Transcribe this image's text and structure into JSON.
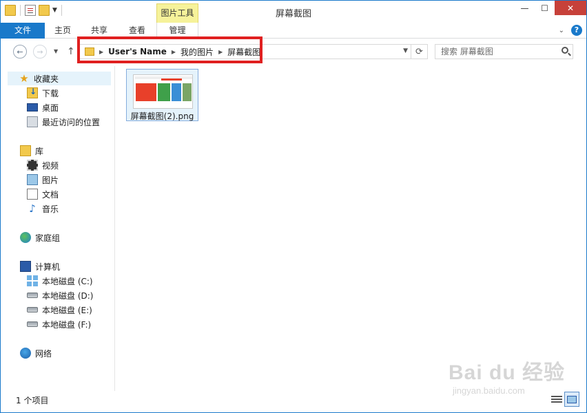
{
  "window": {
    "title": "屏幕截图",
    "contextual_tab_label": "图片工具"
  },
  "ribbon": {
    "tabs": [
      {
        "label": "文件"
      },
      {
        "label": "主页"
      },
      {
        "label": "共享"
      },
      {
        "label": "查看"
      },
      {
        "label": "管理"
      }
    ]
  },
  "address": {
    "breadcrumbs": [
      "User's Name",
      "我的图片",
      "屏幕截图"
    ]
  },
  "search": {
    "placeholder": "搜索 屏幕截图"
  },
  "nav": {
    "favorites": {
      "label": "收藏夹",
      "items": [
        {
          "label": "下载",
          "icon": "download-folder-icon"
        },
        {
          "label": "桌面",
          "icon": "desktop-icon"
        },
        {
          "label": "最近访问的位置",
          "icon": "recent-places-icon"
        }
      ]
    },
    "libraries": {
      "label": "库",
      "items": [
        {
          "label": "视频",
          "icon": "video-library-icon"
        },
        {
          "label": "图片",
          "icon": "picture-library-icon"
        },
        {
          "label": "文档",
          "icon": "document-library-icon"
        },
        {
          "label": "音乐",
          "icon": "music-library-icon"
        }
      ]
    },
    "homegroup": {
      "label": "家庭组"
    },
    "computer": {
      "label": "计算机",
      "items": [
        {
          "label": "本地磁盘 (C:)",
          "icon": "windows-drive-icon"
        },
        {
          "label": "本地磁盘 (D:)",
          "icon": "drive-icon"
        },
        {
          "label": "本地磁盘 (E:)",
          "icon": "drive-icon"
        },
        {
          "label": "本地磁盘 (F:)",
          "icon": "drive-icon"
        }
      ]
    },
    "network": {
      "label": "网络"
    }
  },
  "files": [
    {
      "name": "屏幕截图(2).png",
      "selected": true
    }
  ],
  "status": {
    "item_count": "1 个项目"
  },
  "watermark": {
    "brand": "Bai du 经验",
    "url": "jingyan.baidu.com"
  },
  "colors": {
    "accent": "#1979ca",
    "contextual_tab": "#f6f29a",
    "close_button": "#c7413a",
    "highlight_box": "#e02020",
    "selection": "#e5f3fb"
  }
}
